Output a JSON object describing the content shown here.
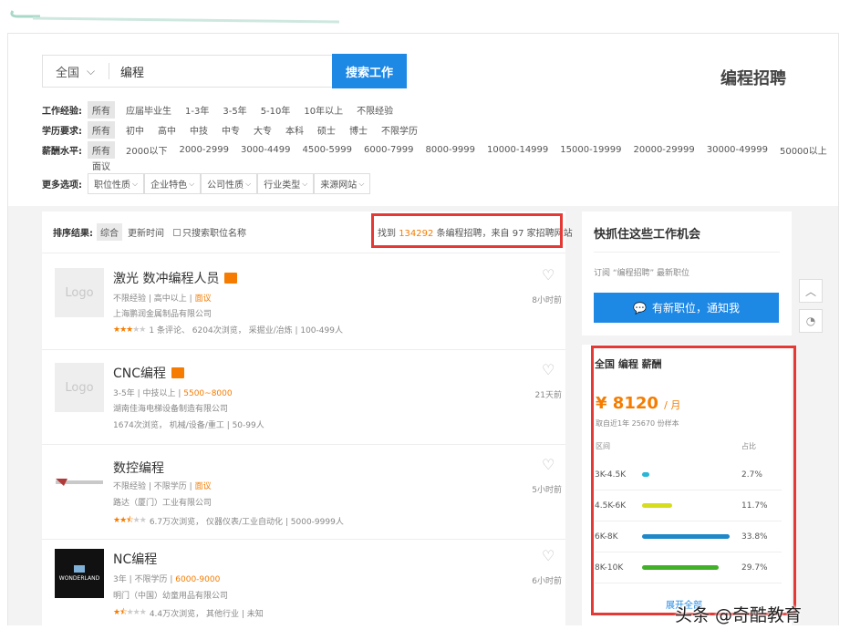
{
  "search": {
    "region": "全国",
    "keyword": "编程",
    "button": "搜索工作"
  },
  "brand": "编程招聘",
  "filters": {
    "experience": {
      "label": "工作经验:",
      "options": [
        "所有",
        "应届毕业生",
        "1-3年",
        "3-5年",
        "5-10年",
        "10年以上",
        "不限经验"
      ]
    },
    "education": {
      "label": "学历要求:",
      "options": [
        "所有",
        "初中",
        "高中",
        "中技",
        "中专",
        "大专",
        "本科",
        "硕士",
        "博士",
        "不限学历"
      ]
    },
    "salary": {
      "label": "薪酬水平:",
      "options": [
        "所有",
        "2000以下",
        "2000-2999",
        "3000-4499",
        "4500-5999",
        "6000-7999",
        "8000-9999",
        "10000-14999",
        "15000-19999",
        "20000-29999",
        "30000-49999",
        "50000以上",
        "面议"
      ]
    },
    "more": {
      "label": "更多选项:",
      "options": [
        "职位性质",
        "企业特色",
        "公司性质",
        "行业类型",
        "来源网站"
      ]
    }
  },
  "sort": {
    "label": "排序结果:",
    "options": [
      "综合",
      "更新时间"
    ],
    "checkbox": "只搜索职位名称"
  },
  "found": {
    "pre": "找到",
    "count": "134292",
    "mid": "条编程招聘，来自",
    "sites": "97",
    "post": "家招聘网站"
  },
  "jobs": [
    {
      "logo": "Logo",
      "title": "激光 数冲编程人员",
      "meta": [
        "不限经验",
        "高中以上"
      ],
      "salary": "面议",
      "company": "上海鹏润金属制品有限公司",
      "rating": "1 条评论、 6204次浏览， 采掘业/冶炼 | 100-499人",
      "stars": 3,
      "time": "8小时前"
    },
    {
      "logo": "Logo",
      "title": "CNC编程",
      "meta": [
        "3-5年",
        "中技以上"
      ],
      "salary": "5500~8000",
      "company": "湖南佳海电梯设备制造有限公司",
      "rating": "1674次浏览， 机械/设备/重工 | 50-99人",
      "stars": 0,
      "time": "21天前"
    },
    {
      "logo": "",
      "title": "数控编程",
      "meta": [
        "不限经验",
        "不限学历"
      ],
      "salary": "面议",
      "company": "路达（厦门）工业有限公司",
      "rating": "6.7万次浏览， 仪器仪表/工业自动化 | 5000-9999人",
      "stars": 2.5,
      "time": "5小时前"
    },
    {
      "logo": "WONDERLAND",
      "title": "NC编程",
      "meta": [
        "3年",
        "不限学历"
      ],
      "salary": "6000-9000",
      "company": "明门（中国）幼童用品有限公司",
      "rating": "4.4万次浏览， 其他行业 | 未知",
      "stars": 1.5,
      "time": "6小时前"
    }
  ],
  "side": {
    "title": "快抓住这些工作机会",
    "sub": "订阅 “编程招聘” 最新职位",
    "notify": "有新职位，通知我"
  },
  "salary_panel": {
    "title": "全国 编程 薪酬",
    "value": "¥ 8120",
    "unit": "/ 月",
    "sample": "取自近1年 25670 份样本",
    "col1": "区间",
    "col2": "占比",
    "rows": [
      {
        "range": "3K-4.5K",
        "pct": "2.7%",
        "frac": 0.027,
        "color": "#29b6d6"
      },
      {
        "range": "4.5K-6K",
        "pct": "11.7%",
        "frac": 0.117,
        "color": "#d6dc1e"
      },
      {
        "range": "6K-8K",
        "pct": "33.8%",
        "frac": 0.338,
        "color": "#1e88c8"
      },
      {
        "range": "8K-10K",
        "pct": "29.7%",
        "frac": 0.297,
        "color": "#43b02a"
      }
    ],
    "more": "展开全部"
  },
  "watermark": "头条 @奇酷教育"
}
